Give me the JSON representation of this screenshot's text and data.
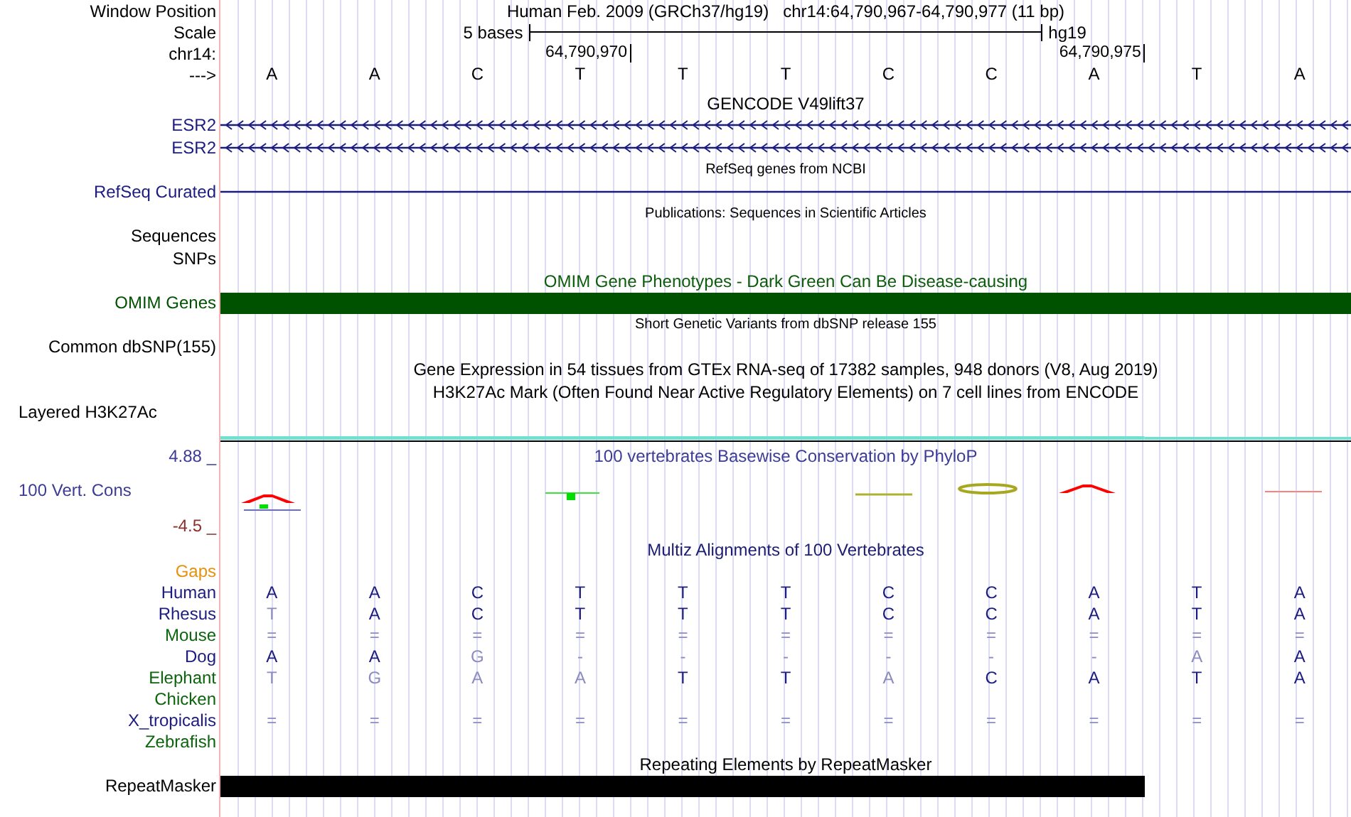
{
  "window_position": {
    "label": "Window Position",
    "assembly_title": "Human Feb. 2009 (GRCh37/hg19)",
    "position": "chr14:64,790,967-64,790,977 (11 bp)"
  },
  "scale": {
    "label": "Scale",
    "length": "5 bases",
    "assembly": "hg19"
  },
  "coordinates": {
    "label": "chr14:",
    "ticks": [
      "64,790,970",
      "64,790,975"
    ]
  },
  "sequence": {
    "label": "--->",
    "bases": [
      "A",
      "A",
      "C",
      "T",
      "T",
      "T",
      "C",
      "C",
      "A",
      "T",
      "A"
    ]
  },
  "tracks": [
    {
      "kind": "title",
      "text": "GENCODE V49lift37",
      "color": "#000000"
    },
    {
      "kind": "gene",
      "label": "ESR2",
      "color": "#1c1c80"
    },
    {
      "kind": "gene",
      "label": "ESR2",
      "color": "#1c1c80"
    },
    {
      "kind": "small_title",
      "text": "RefSeq genes from NCBI",
      "color": "#000000"
    },
    {
      "kind": "line",
      "label": "RefSeq Curated",
      "color": "#1c1c80"
    },
    {
      "kind": "small_title",
      "text": "Publications: Sequences in Scientific Articles",
      "color": "#000000"
    },
    {
      "kind": "empty",
      "label": "Sequences",
      "color": "#000000"
    },
    {
      "kind": "empty",
      "label": "SNPs",
      "color": "#000000"
    },
    {
      "kind": "title",
      "text": "OMIM Gene Phenotypes - Dark Green Can Be Disease-causing",
      "color": "#0c5c0c"
    },
    {
      "kind": "gene_bar",
      "label": "OMIM Genes",
      "color": "#005200"
    },
    {
      "kind": "small_title",
      "text": "Short Genetic Variants from dbSNP release 155",
      "color": "#000000"
    },
    {
      "kind": "empty",
      "label": "Common dbSNP(155)",
      "color": "#000000"
    },
    {
      "kind": "title",
      "text": "Gene Expression in 54 tissues from GTEx RNA-seq of 17382 samples, 948 donors (V8, Aug 2019)",
      "color": "#000000"
    },
    {
      "kind": "title",
      "text": "H3K27Ac Mark (Often Found Near Active Regulatory Elements) on 7 cell lines from ENCODE",
      "color": "#000000"
    },
    {
      "kind": "layered",
      "label": "Layered H3K27Ac",
      "color": "#000000"
    },
    {
      "kind": "wiggle",
      "label": "100 Vert. Cons",
      "max": "4.88 _",
      "min": "-4.5 _",
      "text": "100 vertebrates Basewise Conservation by PhyloP",
      "color": "#3c3c96"
    },
    {
      "kind": "title",
      "text": "Multiz Alignments of 100 Vertebrates",
      "color": "#1c1c70"
    },
    {
      "kind": "empty",
      "label": "Gaps",
      "color": "#e8900c"
    },
    {
      "kind": "alignment",
      "label": "Human",
      "color": "#1c1c80",
      "bases": [
        {
          "text": "A",
          "faded": false
        },
        {
          "text": "A",
          "faded": false
        },
        {
          "text": "C",
          "faded": false
        },
        {
          "text": "T",
          "faded": false
        },
        {
          "text": "T",
          "faded": false
        },
        {
          "text": "T",
          "faded": false
        },
        {
          "text": "C",
          "faded": false
        },
        {
          "text": "C",
          "faded": false
        },
        {
          "text": "A",
          "faded": false
        },
        {
          "text": "T",
          "faded": false
        },
        {
          "text": "A",
          "faded": false
        }
      ]
    },
    {
      "kind": "alignment",
      "label": "Rhesus",
      "color": "#1c1c80",
      "bases": [
        {
          "text": "T",
          "faded": true
        },
        {
          "text": "A",
          "faded": false
        },
        {
          "text": "C",
          "faded": false
        },
        {
          "text": "T",
          "faded": false
        },
        {
          "text": "T",
          "faded": false
        },
        {
          "text": "T",
          "faded": false
        },
        {
          "text": "C",
          "faded": false
        },
        {
          "text": "C",
          "faded": false
        },
        {
          "text": "A",
          "faded": false
        },
        {
          "text": "T",
          "faded": false
        },
        {
          "text": "A",
          "faded": false
        }
      ]
    },
    {
      "kind": "alignment",
      "label": "Mouse",
      "color": "#0c640c",
      "bases": [
        {
          "text": "=",
          "faded": true
        },
        {
          "text": "=",
          "faded": true
        },
        {
          "text": "=",
          "faded": true
        },
        {
          "text": "=",
          "faded": true
        },
        {
          "text": "=",
          "faded": true
        },
        {
          "text": "=",
          "faded": true
        },
        {
          "text": "=",
          "faded": true
        },
        {
          "text": "=",
          "faded": true
        },
        {
          "text": "=",
          "faded": true
        },
        {
          "text": "=",
          "faded": true
        },
        {
          "text": "=",
          "faded": true
        }
      ]
    },
    {
      "kind": "alignment",
      "label": "Dog",
      "color": "#1c1c80",
      "bases": [
        {
          "text": "A",
          "faded": false
        },
        {
          "text": "A",
          "faded": false
        },
        {
          "text": "G",
          "faded": true
        },
        {
          "text": "-",
          "faded": true
        },
        {
          "text": "-",
          "faded": true
        },
        {
          "text": "-",
          "faded": true
        },
        {
          "text": "-",
          "faded": true
        },
        {
          "text": "-",
          "faded": true
        },
        {
          "text": "-",
          "faded": true
        },
        {
          "text": "A",
          "faded": true
        },
        {
          "text": "A",
          "faded": false
        }
      ]
    },
    {
      "kind": "alignment",
      "label": "Elephant",
      "color": "#0c640c",
      "bases": [
        {
          "text": "T",
          "faded": true
        },
        {
          "text": "G",
          "faded": true
        },
        {
          "text": "A",
          "faded": true
        },
        {
          "text": "A",
          "faded": true
        },
        {
          "text": "T",
          "faded": false
        },
        {
          "text": "T",
          "faded": false
        },
        {
          "text": "A",
          "faded": true
        },
        {
          "text": "C",
          "faded": false
        },
        {
          "text": "A",
          "faded": false
        },
        {
          "text": "T",
          "faded": false
        },
        {
          "text": "A",
          "faded": false
        }
      ]
    },
    {
      "kind": "empty",
      "label": "Chicken",
      "color": "#0c640c"
    },
    {
      "kind": "alignment",
      "label": "X_tropicalis",
      "color": "#1c1c80",
      "bases": [
        {
          "text": "=",
          "faded": true
        },
        {
          "text": "=",
          "faded": true
        },
        {
          "text": "=",
          "faded": true
        },
        {
          "text": "=",
          "faded": true
        },
        {
          "text": "=",
          "faded": true
        },
        {
          "text": "=",
          "faded": true
        },
        {
          "text": "=",
          "faded": true
        },
        {
          "text": "=",
          "faded": true
        },
        {
          "text": "=",
          "faded": true
        },
        {
          "text": "=",
          "faded": true
        },
        {
          "text": "=",
          "faded": true
        }
      ]
    },
    {
      "kind": "empty",
      "label": "Zebrafish",
      "color": "#0c640c"
    },
    {
      "kind": "title",
      "text": "Repeating Elements by RepeatMasker",
      "color": "#000000"
    },
    {
      "kind": "repeat_bar",
      "label": "RepeatMasker",
      "color": "#000000"
    }
  ]
}
